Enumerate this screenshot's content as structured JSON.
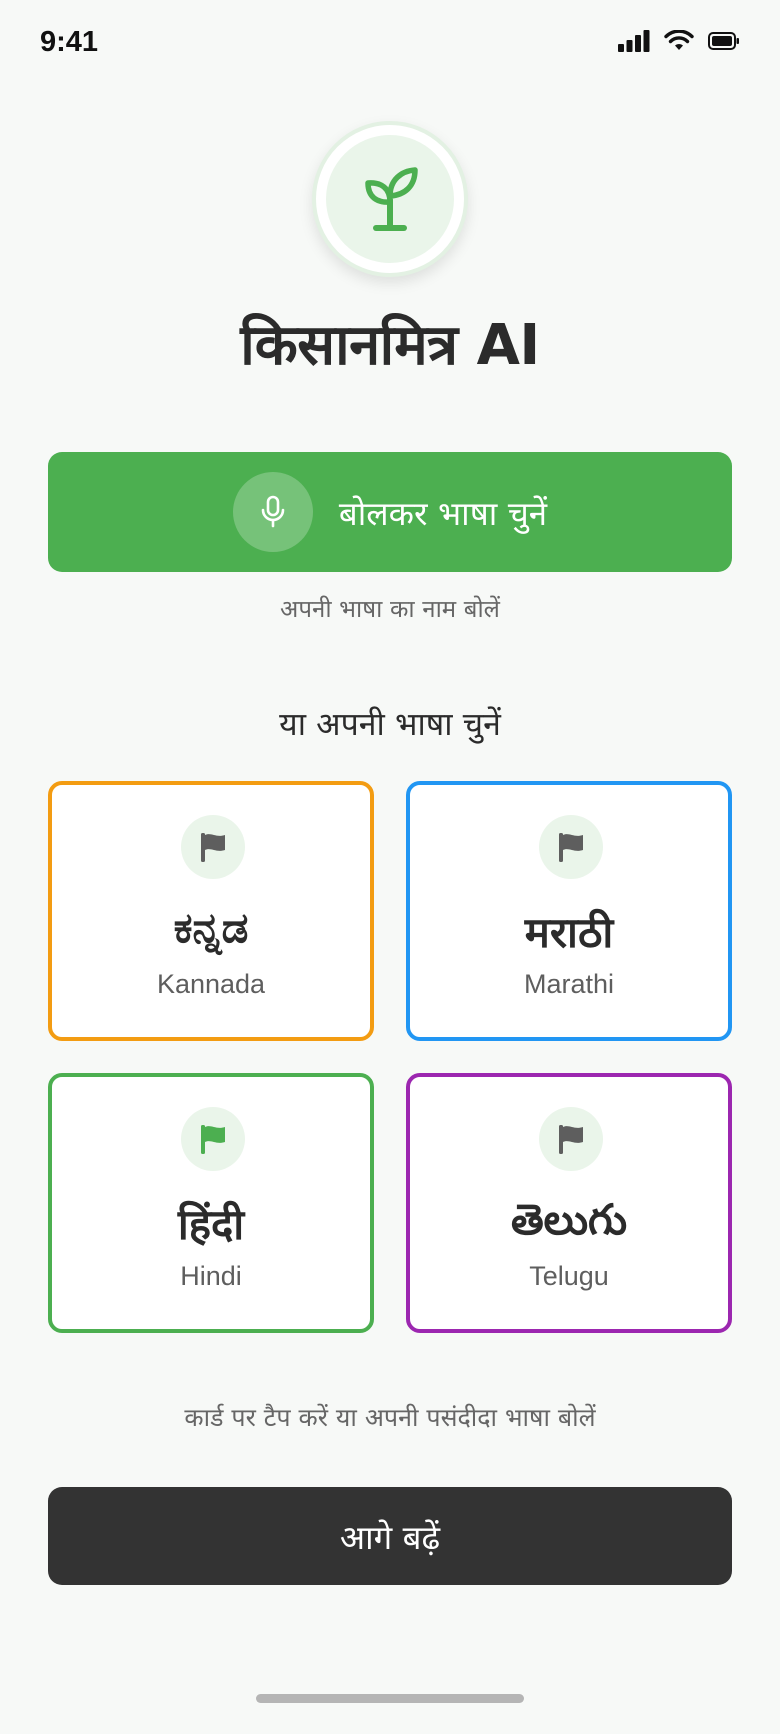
{
  "status_bar": {
    "time": "9:41"
  },
  "app": {
    "title": "किसानमित्र AI",
    "logo_icon": "seedling-icon",
    "brand_color": "#4caf50"
  },
  "voice": {
    "button_label": "बोलकर भाषा चुनें",
    "icon": "microphone-icon",
    "hint": "अपनी भाषा का नाम बोलें"
  },
  "or_heading": "या अपनी भाषा चुनें",
  "languages": [
    {
      "native": "ಕನ್ನಡ",
      "english": "Kannada",
      "border_color": "#f39c12",
      "flag_color": "#5e5e5e",
      "selected": false
    },
    {
      "native": "मराठी",
      "english": "Marathi",
      "border_color": "#2196f3",
      "flag_color": "#5e5e5e",
      "selected": false
    },
    {
      "native": "हिंदी",
      "english": "Hindi",
      "border_color": "#4caf50",
      "flag_color": "#4caf50",
      "selected": true
    },
    {
      "native": "తెలుగు",
      "english": "Telugu",
      "border_color": "#9c27b0",
      "flag_color": "#5e5e5e",
      "selected": false
    }
  ],
  "bottom_hint": "कार्ड पर टैप करें या अपनी पसंदीदा भाषा बोलें",
  "continue_label": "आगे बढ़ें"
}
